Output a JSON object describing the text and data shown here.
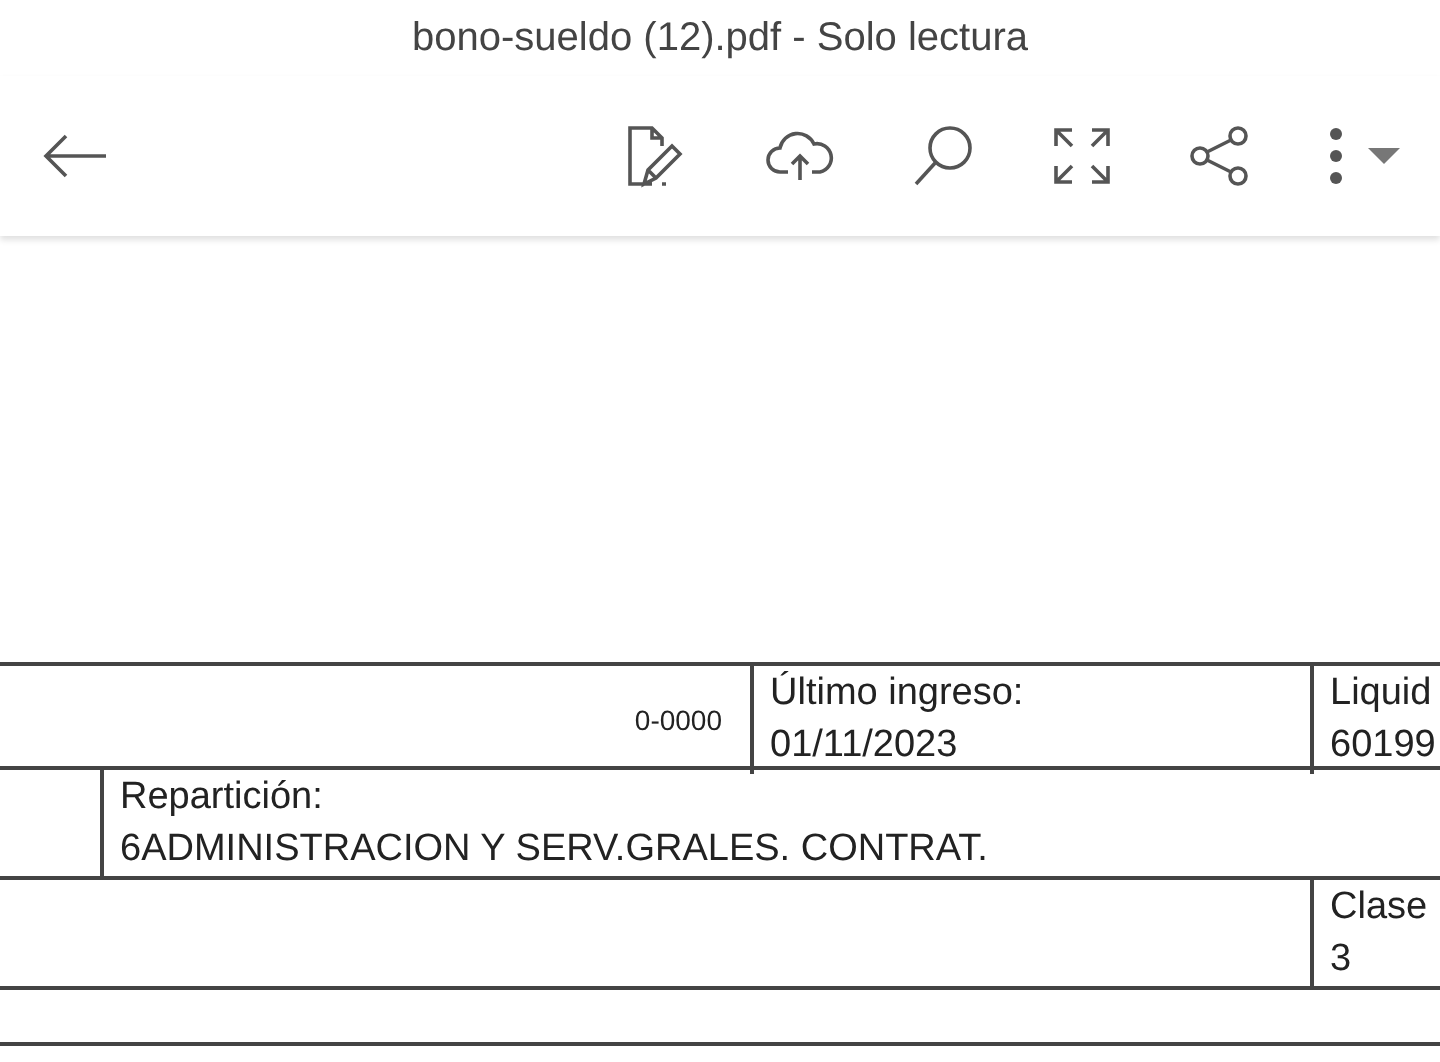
{
  "window": {
    "title": "bono-sueldo (12).pdf - Solo lectura"
  },
  "document": {
    "rows": [
      {
        "kind": "triple",
        "cells": [
          {
            "kind": "code",
            "text": "0-0000"
          },
          {
            "kind": "field",
            "label": "Último ingreso:",
            "value": "01/11/2023"
          },
          {
            "kind": "field",
            "label": "Liquid",
            "value": "60199"
          }
        ]
      },
      {
        "kind": "indented",
        "cells": [
          "",
          {
            "kind": "field",
            "label": "Repartición:",
            "value": "6ADMINISTRACION Y SERV.GRALES. CONTRAT."
          }
        ]
      },
      {
        "kind": "trailing",
        "cells": [
          "",
          "",
          {
            "kind": "field",
            "label": "Clase",
            "value": "3"
          }
        ]
      },
      {
        "kind": "blank",
        "cells": []
      }
    ]
  }
}
